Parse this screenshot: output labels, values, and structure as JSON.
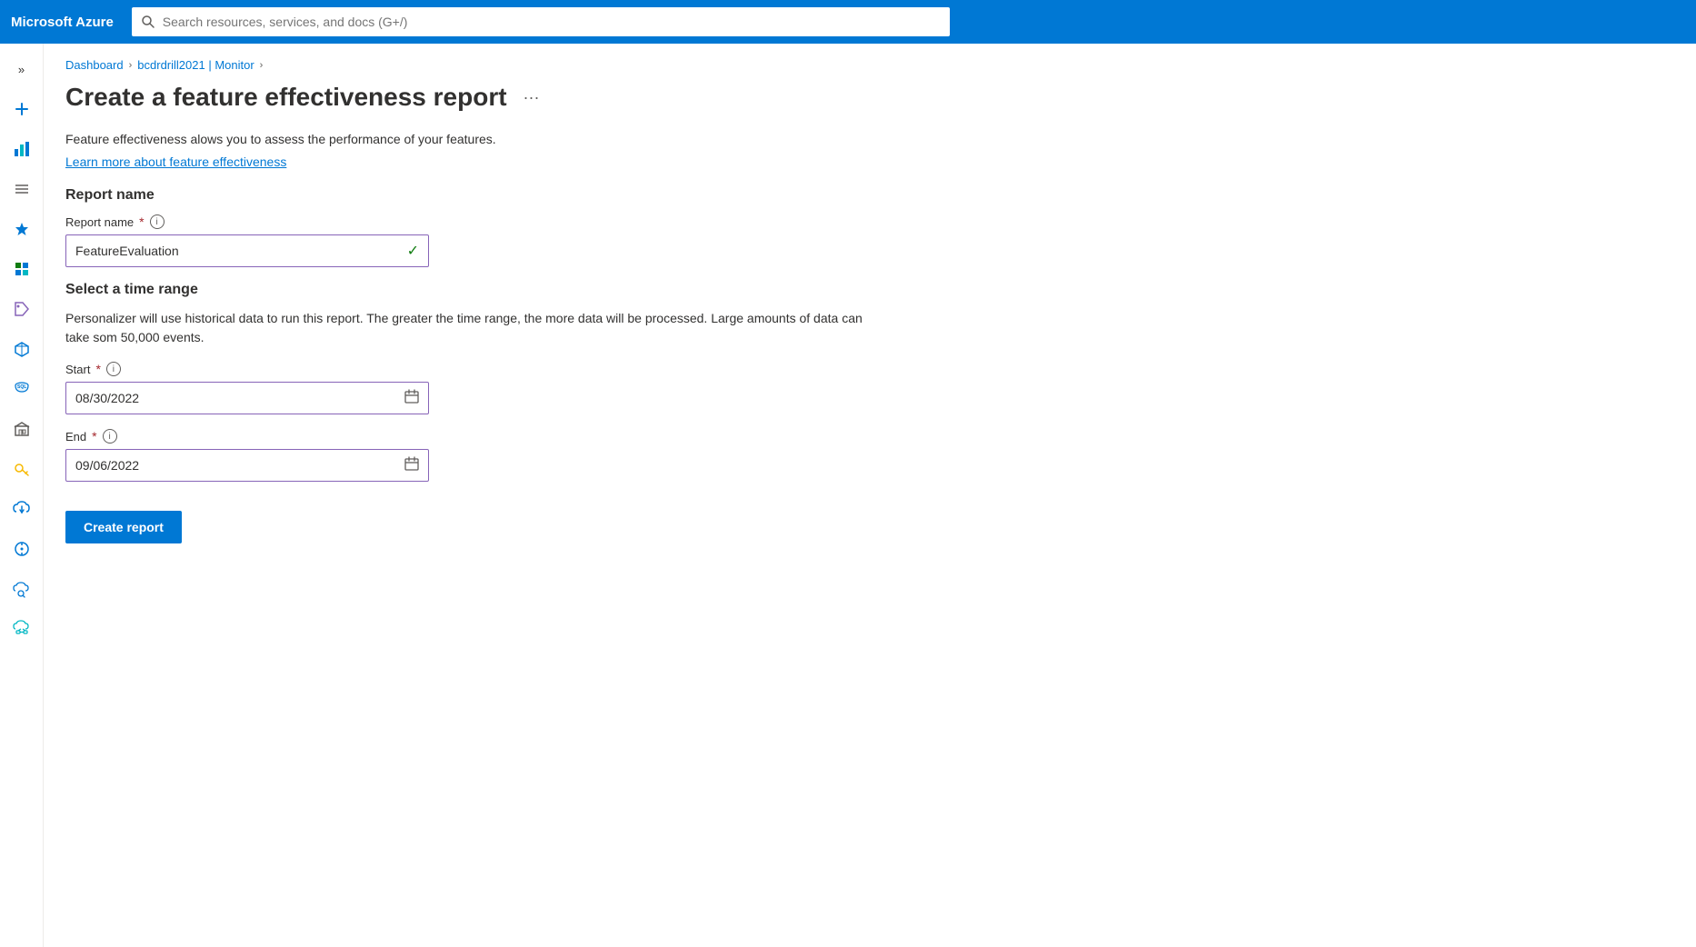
{
  "topbar": {
    "brand": "Microsoft Azure",
    "search_placeholder": "Search resources, services, and docs (G+/)"
  },
  "breadcrumb": {
    "items": [
      {
        "label": "Dashboard",
        "link": true
      },
      {
        "label": "bcdrdrill2021 | Monitor",
        "link": true
      }
    ],
    "separator": "›"
  },
  "page": {
    "title": "Create a feature effectiveness report",
    "more_options_label": "···",
    "description": "Feature effectiveness alows you to assess the performance of your features.",
    "learn_more_text": "Learn more about feature effectiveness"
  },
  "report_name_section": {
    "title": "Report name",
    "field_label": "Report name",
    "required_marker": "*",
    "info_marker": "i",
    "value": "FeatureEvaluation",
    "check_icon": "✓"
  },
  "time_range_section": {
    "title": "Select a time range",
    "description": "Personalizer will use historical data to run this report. The greater the time range, the more data will be processed. Large amounts of data can take som 50,000 events.",
    "start_label": "Start",
    "start_required": "*",
    "start_info": "i",
    "start_value": "08/30/2022",
    "end_label": "End",
    "end_required": "*",
    "end_info": "i",
    "end_value": "09/06/2022"
  },
  "actions": {
    "create_report_label": "Create report"
  },
  "sidebar": {
    "expand_label": "»",
    "items": [
      {
        "icon": "plus",
        "label": "New"
      },
      {
        "icon": "chart",
        "label": "Analytics"
      },
      {
        "icon": "list",
        "label": "All resources"
      },
      {
        "icon": "star",
        "label": "Favorites"
      },
      {
        "icon": "grid",
        "label": "Dashboard"
      },
      {
        "icon": "tag",
        "label": "Tags"
      },
      {
        "icon": "cube",
        "label": "Resource groups"
      },
      {
        "icon": "sql",
        "label": "SQL"
      },
      {
        "icon": "building",
        "label": "Marketplace"
      },
      {
        "icon": "key",
        "label": "Keys"
      },
      {
        "icon": "cloud-sync",
        "label": "Cloud sync"
      },
      {
        "icon": "compass",
        "label": "Compass"
      },
      {
        "icon": "search-cloud",
        "label": "Search cloud"
      },
      {
        "icon": "cloud-network",
        "label": "Cloud network"
      }
    ]
  }
}
